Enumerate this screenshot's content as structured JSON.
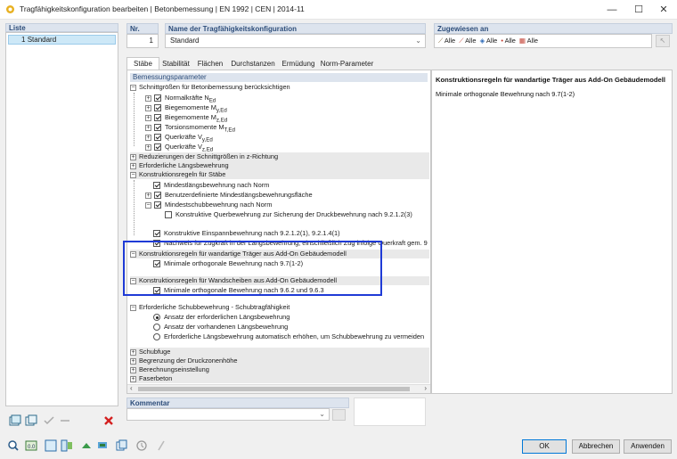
{
  "window": {
    "title": "Tragfähigkeitskonfiguration bearbeiten | Betonbemessung | EN 1992 | CEN | 2014-11",
    "minimize": "—",
    "maximize": "☐",
    "close": "✕"
  },
  "list": {
    "label": "Liste",
    "items": [
      {
        "number": "1",
        "name": "Standard"
      }
    ]
  },
  "nr": {
    "label": "Nr.",
    "value": "1"
  },
  "name_field": {
    "label": "Name der Tragfähigkeitskonfiguration",
    "value": "Standard"
  },
  "assigned": {
    "label": "Zugewiesen an",
    "items": [
      "Alle",
      "Alle",
      "Alle",
      "Alle",
      "Alle"
    ],
    "colors": [
      "#7a5c2e",
      "#c0392b",
      "#2e6bb8",
      "#c0392b",
      "#c0392b"
    ]
  },
  "tabs": [
    "Stäbe",
    "Stabilität",
    "Flächen",
    "Durchstanzen",
    "Ermüdung",
    "Norm-Parameter"
  ],
  "params": {
    "header": "Bemessungsparameter",
    "s1": {
      "title": "Schnittgrößen für Betonbemessung berücksichtigen",
      "items": [
        "Normalkräfte N",
        "Biegemomente M",
        "Biegemomente M",
        "Torsionsmomente M",
        "Querkräfte V",
        "Querkräfte V"
      ],
      "subs": [
        "Ed",
        "y,Ed",
        "z,Ed",
        "T,Ed",
        "y,Ed",
        "z,Ed"
      ]
    },
    "s2": "Reduzierungen der Schnittgrößen in z-Richtung",
    "s3": "Erforderliche Längsbewehrung",
    "s4": {
      "title": "Konstruktionsregeln für Stäbe",
      "items": [
        "Mindestlängsbewehrung nach Norm",
        "Benutzerdefinierte Mindestlängsbewehrungsfläche",
        "Mindestschubbewehrung nach Norm",
        "Konstruktive Querbewehrung zur Sicherung der Druckbewehrung nach 9.2.1.2(3)",
        "Konstruktive Einspannbewehrung nach 9.2.1.2(1), 9.2.1.4(1)",
        "Nachweis für Zugkraft in der Längsbewehrung, einschließlich Zug infolge Querkraft gem. 9"
      ]
    },
    "s5": {
      "title": "Konstruktionsregeln für wandartige Träger aus Add-On Gebäudemodell",
      "item": "Minimale orthogonale Bewehrung nach 9.7(1-2)"
    },
    "s6": {
      "title": "Konstruktionsregeln für Wandscheiben aus Add-On Gebäudemodell",
      "item": "Minimale orthogonale Bewehrung nach 9.6.2 und 9.6.3"
    },
    "s7": {
      "title": "Erforderliche Schubbewehrung - Schubtragfähigkeit",
      "items": [
        "Ansatz der erforderlichen Längsbewehrung",
        "Ansatz der vorhandenen Längsbewehrung",
        "Erforderliche Längsbewehrung automatisch erhöhen, um Schubbewehrung zu vermeiden"
      ]
    },
    "s8": "Schubfuge",
    "s9": "Begrenzung der Druckzonenhöhe",
    "s10": "Berechnungseinstellung",
    "s11": "Faserbeton"
  },
  "info": {
    "title": "Konstruktionsregeln für wandartige Träger aus Add-On Gebäudemodell",
    "text": "Minimale orthogonale Bewehrung nach 9.7(1-2)"
  },
  "comment": {
    "label": "Kommentar",
    "value": ""
  },
  "buttons": {
    "ok": "OK",
    "cancel": "Abbrechen",
    "apply": "Anwenden"
  }
}
